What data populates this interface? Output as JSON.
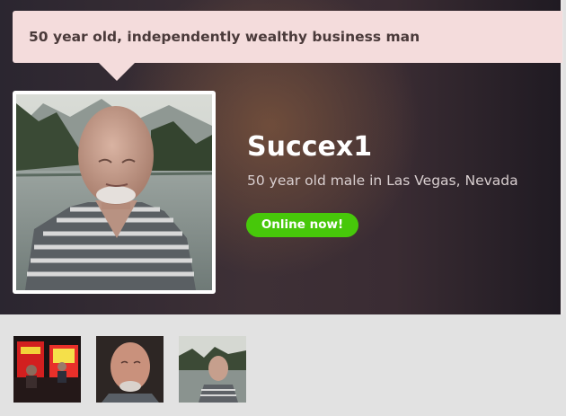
{
  "profile": {
    "tagline": "50 year old, independently wealthy business man",
    "username": "Succex1",
    "location": "50 year old male in Las Vegas, Nevada",
    "status": "Online now!"
  },
  "thumbnails": [
    {
      "icon": "conference-photo"
    },
    {
      "icon": "face-photo"
    },
    {
      "icon": "lake-portrait-photo"
    }
  ],
  "colors": {
    "online": "#47c80a",
    "tagline_bg": "#f4dcdc"
  }
}
